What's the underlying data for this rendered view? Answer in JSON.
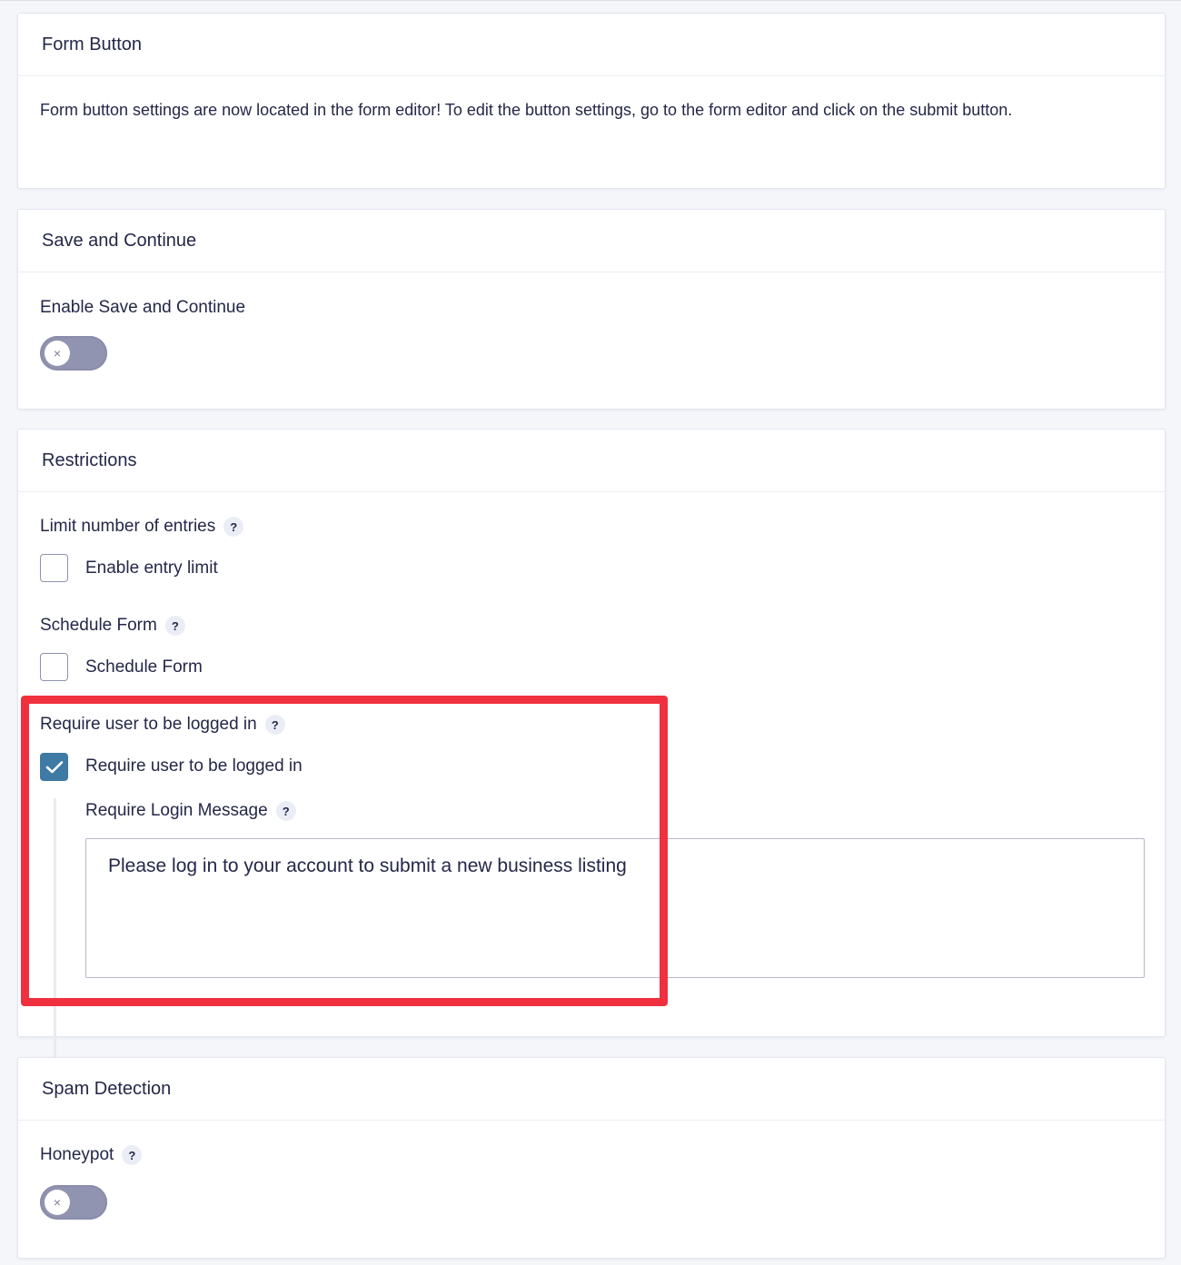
{
  "form_button": {
    "title": "Form Button",
    "description": "Form button settings are now located in the form editor! To edit the button settings, go to the form editor and click on the submit button."
  },
  "save_continue": {
    "title": "Save and Continue",
    "enable_label": "Enable Save and Continue",
    "toggle_on": false
  },
  "restrictions": {
    "title": "Restrictions",
    "limit_entries_label": "Limit number of entries",
    "enable_entry_limit": "Enable entry limit",
    "schedule_form_label": "Schedule Form",
    "schedule_form_checkbox": "Schedule Form",
    "require_login_label": "Require user to be logged in",
    "require_login_checkbox": "Require user to be logged in",
    "require_login_checked": true,
    "login_message_label": "Require Login Message",
    "login_message_value": "Please log in to your account to submit a new business listing"
  },
  "spam": {
    "title": "Spam Detection",
    "honeypot_label": "Honeypot",
    "toggle_on": false
  },
  "icons": {
    "help": "?",
    "close": "×",
    "check": "check-icon"
  },
  "colors": {
    "accent": "#3e7aa4",
    "highlight": "#f0303f",
    "toggle_off": "#9194b0"
  }
}
